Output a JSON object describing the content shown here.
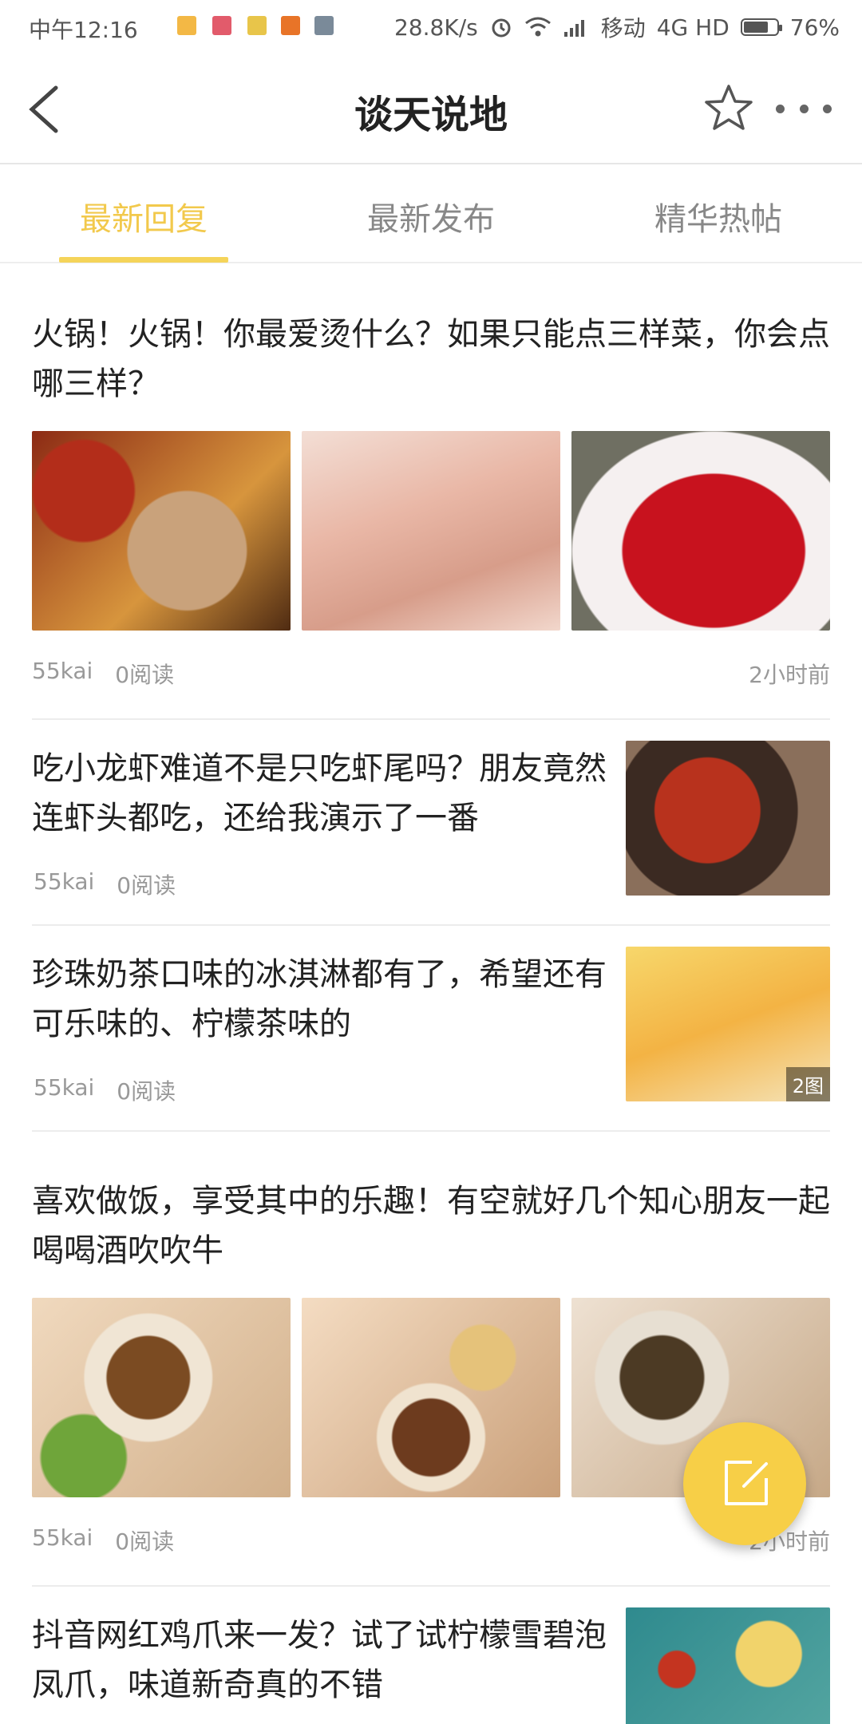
{
  "status_bar": {
    "time": "中午12:16",
    "speed": "28.8K/s",
    "carrier": "移动",
    "network": "4G HD",
    "battery": "76%",
    "battery_level": 0.76
  },
  "nav": {
    "title": "谈天说地",
    "back_icon": "back-arrow-icon",
    "favorite_icon": "star-icon",
    "more_icon": "more-icon"
  },
  "tabs": [
    {
      "label": "最新回复",
      "active": true
    },
    {
      "label": "最新发布",
      "active": false
    },
    {
      "label": "精华热帖",
      "active": false
    }
  ],
  "colors": {
    "accent": "#f2c94c",
    "fab": "#f7cf47"
  },
  "posts": [
    {
      "title": "火锅！火锅！你最爱烫什么？如果只能点三样菜，你会点哪三样？",
      "author": "55kai",
      "reads": "0阅读",
      "time": "2小时前"
    },
    {
      "title": "吃小龙虾难道不是只吃虾尾吗？朋友竟然连虾头都吃，还给我演示了一番",
      "author": "55kai",
      "reads": "0阅读"
    },
    {
      "title": "珍珠奶茶口味的冰淇淋都有了，希望还有可乐味的、柠檬茶味的",
      "author": "55kai",
      "reads": "0阅读",
      "image_count": "2图"
    },
    {
      "title": "喜欢做饭，享受其中的乐趣！有空就好几个知心朋友一起喝喝酒吹吹牛",
      "author": "55kai",
      "reads": "0阅读",
      "time": "2小时前"
    },
    {
      "title": "抖音网红鸡爪来一发？试了试柠檬雪碧泡凤爪，味道新奇真的不错"
    }
  ],
  "fab_icon": "compose-icon"
}
